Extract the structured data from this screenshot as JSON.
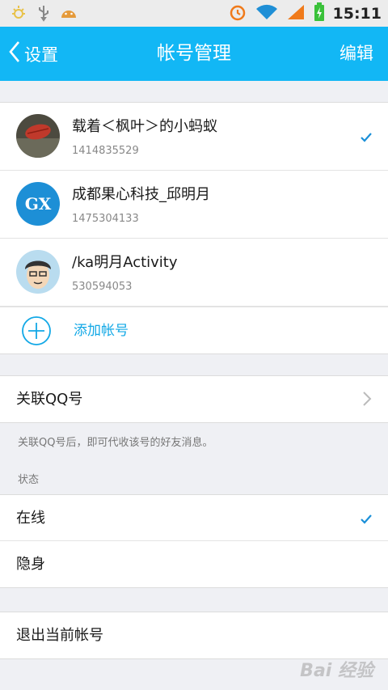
{
  "statusbar": {
    "time": "15:11",
    "icons": [
      "weather-icon",
      "usb-icon",
      "android-icon",
      "alarm-icon",
      "wifi-icon",
      "signal-icon",
      "battery-icon"
    ]
  },
  "header": {
    "back_label": "设置",
    "title": "帐号管理",
    "edit_label": "编辑"
  },
  "accounts": [
    {
      "name": "载着＜枫叶＞的小蚂蚁",
      "id": "1414835529",
      "selected": true,
      "avatar": "photo-leaf"
    },
    {
      "name": "成都果心科技_邱明月",
      "id": "1475304133",
      "selected": false,
      "avatar": "gx-logo",
      "avatar_text": "GX"
    },
    {
      "name": "/ka明月Activity",
      "id": "530594053",
      "selected": false,
      "avatar": "cartoon-face"
    }
  ],
  "add_account_label": "添加帐号",
  "link_qq": {
    "label": "关联QQ号",
    "hint": "关联QQ号后，即可代收该号的好友消息。"
  },
  "status_section": {
    "header": "状态",
    "options": [
      {
        "label": "在线",
        "selected": true
      },
      {
        "label": "隐身",
        "selected": false
      }
    ]
  },
  "logout_label": "退出当前帐号",
  "watermark": "Bai 经验",
  "colors": {
    "accent": "#12b7f5",
    "link": "#12a8e6",
    "check": "#1a8fd8",
    "background": "#eff0f4"
  }
}
